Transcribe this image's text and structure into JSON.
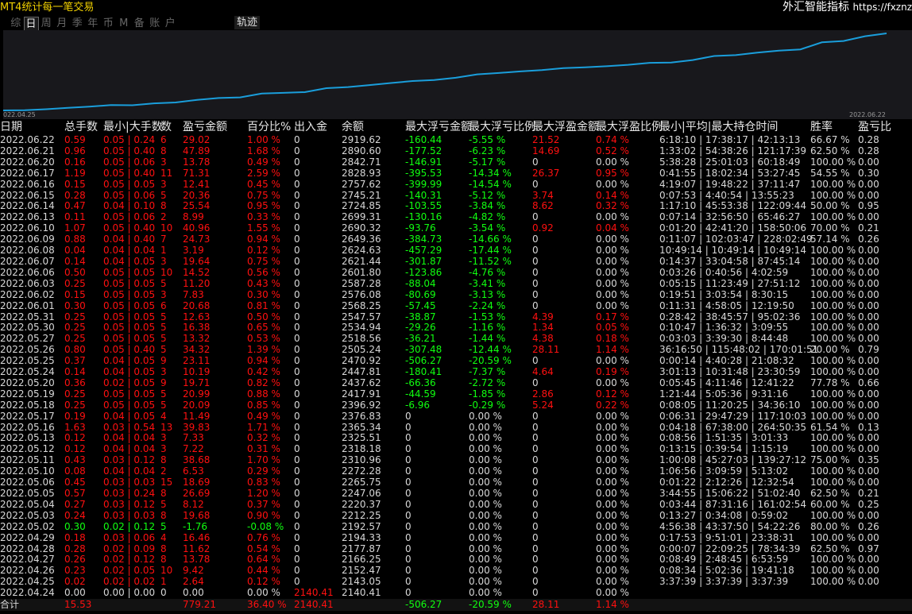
{
  "app": {
    "title": "MT4统计每一笔交易",
    "brand": "外汇智能指标",
    "url": "https://fxznz"
  },
  "tabs": [
    {
      "label": "综",
      "active": false
    },
    {
      "label": "日",
      "active": true
    },
    {
      "label": "周",
      "active": false
    },
    {
      "label": "月",
      "active": false
    },
    {
      "label": "季",
      "active": false
    },
    {
      "label": "年",
      "active": false
    },
    {
      "label": "币",
      "active": false
    },
    {
      "label": "M",
      "active": false
    },
    {
      "label": "备",
      "active": false
    },
    {
      "label": "账",
      "active": false
    },
    {
      "label": "户",
      "active": false
    }
  ],
  "track_button": "轨迹",
  "chart": {
    "start_label": "022.04.25",
    "end_label": "2022.06.22",
    "line_color": "#1a9edb"
  },
  "chart_data": {
    "type": "line",
    "x_start": "2022.04.24",
    "x_end": "2022.06.22",
    "y_series": [
      2140.41,
      2143.05,
      2152.47,
      2166.25,
      2177.87,
      2194.33,
      2192.57,
      2212.25,
      2220.37,
      2247.06,
      2265.75,
      2272.28,
      2310.96,
      2318.18,
      2325.51,
      2365.34,
      2376.83,
      2396.92,
      2417.91,
      2437.62,
      2447.81,
      2470.92,
      2505.24,
      2518.56,
      2534.94,
      2547.57,
      2568.25,
      2576.08,
      2587.28,
      2601.8,
      2621.44,
      2624.63,
      2649.36,
      2690.32,
      2699.31,
      2724.85,
      2745.21,
      2757.62,
      2828.93,
      2842.71,
      2890.6,
      2919.62
    ]
  },
  "headers": [
    "日期",
    "总手数",
    "最小|大手数",
    "数",
    "盈亏金额",
    "百分比%",
    "出入金",
    "余额",
    "最大浮亏金额",
    "最大浮亏比例",
    "最大浮盈金额",
    "最大浮盈比例",
    "最小|平均|最大持仓时间",
    "胜率",
    "盈亏比"
  ],
  "rows": [
    {
      "date": "2022.06.22",
      "lots": "0.59",
      "minmax": "0.05 | 0.24",
      "n": "6",
      "pl": "29.02",
      "pct": "1.00 %",
      "io": "0",
      "bal": "2919.62",
      "mfl": "-160.44",
      "mflp": "-5.55 %",
      "mfp": "21.52",
      "mfpp": "0.74 %",
      "time": "6:18:10 | 17:38:17 | 42:13:13",
      "win": "66.67 %",
      "ratio": "0.28",
      "neg": false
    },
    {
      "date": "2022.06.21",
      "lots": "0.96",
      "minmax": "0.05 | 0.40",
      "n": "8",
      "pl": "47.89",
      "pct": "1.68 %",
      "io": "0",
      "bal": "2890.60",
      "mfl": "-177.52",
      "mflp": "-6.23 %",
      "mfp": "14.69",
      "mfpp": "0.52 %",
      "time": "1:33:02 | 54:38:26 | 121:17:39",
      "win": "62.50 %",
      "ratio": "0.28",
      "neg": false
    },
    {
      "date": "2022.06.20",
      "lots": "0.16",
      "minmax": "0.05 | 0.06",
      "n": "3",
      "pl": "13.78",
      "pct": "0.49 %",
      "io": "0",
      "bal": "2842.71",
      "mfl": "-146.91",
      "mflp": "-5.17 %",
      "mfp": "0",
      "mfpp": "0.00 %",
      "time": "5:38:28 | 25:01:03 | 60:18:49",
      "win": "100.00 %",
      "ratio": "0.00",
      "neg": false
    },
    {
      "date": "2022.06.17",
      "lots": "1.19",
      "minmax": "0.05 | 0.40",
      "n": "11",
      "pl": "71.31",
      "pct": "2.59 %",
      "io": "0",
      "bal": "2828.93",
      "mfl": "-395.53",
      "mflp": "-14.34 %",
      "mfp": "26.37",
      "mfpp": "0.95 %",
      "time": "0:41:55 | 18:02:34 | 53:27:45",
      "win": "54.55 %",
      "ratio": "0.30",
      "neg": false
    },
    {
      "date": "2022.06.16",
      "lots": "0.15",
      "minmax": "0.05 | 0.05",
      "n": "3",
      "pl": "12.41",
      "pct": "0.45 %",
      "io": "0",
      "bal": "2757.62",
      "mfl": "-399.99",
      "mflp": "-14.54 %",
      "mfp": "0",
      "mfpp": "0.00 %",
      "time": "4:19:07 | 19:48:22 | 37:11:47",
      "win": "100.00 %",
      "ratio": "0.00",
      "neg": false
    },
    {
      "date": "2022.06.15",
      "lots": "0.28",
      "minmax": "0.05 | 0.06",
      "n": "5",
      "pl": "20.36",
      "pct": "0.75 %",
      "io": "0",
      "bal": "2745.21",
      "mfl": "-140.31",
      "mflp": "-5.12 %",
      "mfp": "3.74",
      "mfpp": "0.14 %",
      "time": "0:07:53 | 4:40:54 | 13:55:23",
      "win": "100.00 %",
      "ratio": "0.00",
      "neg": false
    },
    {
      "date": "2022.06.14",
      "lots": "0.47",
      "minmax": "0.04 | 0.10",
      "n": "8",
      "pl": "25.54",
      "pct": "0.95 %",
      "io": "0",
      "bal": "2724.85",
      "mfl": "-103.55",
      "mflp": "-3.84 %",
      "mfp": "8.62",
      "mfpp": "0.32 %",
      "time": "1:17:10 | 45:53:38 | 122:09:44",
      "win": "50.00 %",
      "ratio": "0.95",
      "neg": false
    },
    {
      "date": "2022.06.13",
      "lots": "0.11",
      "minmax": "0.05 | 0.06",
      "n": "2",
      "pl": "8.99",
      "pct": "0.33 %",
      "io": "0",
      "bal": "2699.31",
      "mfl": "-130.16",
      "mflp": "-4.82 %",
      "mfp": "0",
      "mfpp": "0.00 %",
      "time": "0:07:14 | 32:56:50 | 65:46:27",
      "win": "100.00 %",
      "ratio": "0.00",
      "neg": false
    },
    {
      "date": "2022.06.10",
      "lots": "1.07",
      "minmax": "0.05 | 0.40",
      "n": "10",
      "pl": "40.96",
      "pct": "1.55 %",
      "io": "0",
      "bal": "2690.32",
      "mfl": "-93.76",
      "mflp": "-3.54 %",
      "mfp": "0.92",
      "mfpp": "0.04 %",
      "time": "0:01:20 | 42:41:20 | 158:50:06",
      "win": "70.00 %",
      "ratio": "0.21",
      "neg": false
    },
    {
      "date": "2022.06.09",
      "lots": "0.88",
      "minmax": "0.04 | 0.40",
      "n": "7",
      "pl": "24.73",
      "pct": "0.94 %",
      "io": "0",
      "bal": "2649.36",
      "mfl": "-384.73",
      "mflp": "-14.66 %",
      "mfp": "0",
      "mfpp": "0.00 %",
      "time": "0:11:07 | 102:03:47 | 228:02:49",
      "win": "57.14 %",
      "ratio": "0.26",
      "neg": false
    },
    {
      "date": "2022.06.08",
      "lots": "0.04",
      "minmax": "0.04 | 0.04",
      "n": "1",
      "pl": "3.19",
      "pct": "0.12 %",
      "io": "0",
      "bal": "2624.63",
      "mfl": "-457.29",
      "mflp": "-17.44 %",
      "mfp": "0",
      "mfpp": "0.00 %",
      "time": "10:49:14 | 10:49:14 | 10:49:14",
      "win": "100.00 %",
      "ratio": "0.00",
      "neg": false
    },
    {
      "date": "2022.06.07",
      "lots": "0.14",
      "minmax": "0.04 | 0.05",
      "n": "3",
      "pl": "19.64",
      "pct": "0.75 %",
      "io": "0",
      "bal": "2621.44",
      "mfl": "-301.87",
      "mflp": "-11.52 %",
      "mfp": "0",
      "mfpp": "0.00 %",
      "time": "0:14:37 | 33:04:58 | 87:45:14",
      "win": "100.00 %",
      "ratio": "0.00",
      "neg": false
    },
    {
      "date": "2022.06.06",
      "lots": "0.50",
      "minmax": "0.05 | 0.05",
      "n": "10",
      "pl": "14.52",
      "pct": "0.56 %",
      "io": "0",
      "bal": "2601.80",
      "mfl": "-123.86",
      "mflp": "-4.76 %",
      "mfp": "0",
      "mfpp": "0.00 %",
      "time": "0:03:26 | 0:40:56 | 4:02:59",
      "win": "100.00 %",
      "ratio": "0.00",
      "neg": false
    },
    {
      "date": "2022.06.03",
      "lots": "0.25",
      "minmax": "0.05 | 0.05",
      "n": "5",
      "pl": "11.20",
      "pct": "0.43 %",
      "io": "0",
      "bal": "2587.28",
      "mfl": "-88.04",
      "mflp": "-3.41 %",
      "mfp": "0",
      "mfpp": "0.00 %",
      "time": "0:05:15 | 11:23:49 | 27:51:12",
      "win": "100.00 %",
      "ratio": "0.00",
      "neg": false
    },
    {
      "date": "2022.06.02",
      "lots": "0.15",
      "minmax": "0.05 | 0.05",
      "n": "3",
      "pl": "7.83",
      "pct": "0.30 %",
      "io": "0",
      "bal": "2576.08",
      "mfl": "-80.69",
      "mflp": "-3.13 %",
      "mfp": "0",
      "mfpp": "0.00 %",
      "time": "0:19:51 | 3:03:54 | 8:30:15",
      "win": "100.00 %",
      "ratio": "0.00",
      "neg": false
    },
    {
      "date": "2022.06.01",
      "lots": "0.30",
      "minmax": "0.05 | 0.05",
      "n": "6",
      "pl": "20.68",
      "pct": "0.81 %",
      "io": "0",
      "bal": "2568.25",
      "mfl": "-57.45",
      "mflp": "-2.24 %",
      "mfp": "0",
      "mfpp": "0.00 %",
      "time": "0:11:31 | 4:58:05 | 12:19:50",
      "win": "100.00 %",
      "ratio": "0.00",
      "neg": false
    },
    {
      "date": "2022.05.31",
      "lots": "0.25",
      "minmax": "0.05 | 0.05",
      "n": "5",
      "pl": "12.63",
      "pct": "0.50 %",
      "io": "0",
      "bal": "2547.57",
      "mfl": "-38.87",
      "mflp": "-1.53 %",
      "mfp": "4.39",
      "mfpp": "0.17 %",
      "time": "0:28:42 | 38:45:57 | 95:02:36",
      "win": "100.00 %",
      "ratio": "0.00",
      "neg": false
    },
    {
      "date": "2022.05.30",
      "lots": "0.25",
      "minmax": "0.05 | 0.05",
      "n": "5",
      "pl": "16.38",
      "pct": "0.65 %",
      "io": "0",
      "bal": "2534.94",
      "mfl": "-29.26",
      "mflp": "-1.16 %",
      "mfp": "1.34",
      "mfpp": "0.05 %",
      "time": "0:10:47 | 1:36:32 | 3:09:55",
      "win": "100.00 %",
      "ratio": "0.00",
      "neg": false
    },
    {
      "date": "2022.05.27",
      "lots": "0.25",
      "minmax": "0.05 | 0.05",
      "n": "5",
      "pl": "13.32",
      "pct": "0.53 %",
      "io": "0",
      "bal": "2518.56",
      "mfl": "-36.21",
      "mflp": "-1.44 %",
      "mfp": "4.38",
      "mfpp": "0.18 %",
      "time": "0:03:03 | 3:39:30 | 8:44:48",
      "win": "100.00 %",
      "ratio": "0.00",
      "neg": false
    },
    {
      "date": "2022.05.26",
      "lots": "0.80",
      "minmax": "0.05 | 0.40",
      "n": "5",
      "pl": "34.32",
      "pct": "1.39 %",
      "io": "0",
      "bal": "2505.24",
      "mfl": "-307.48",
      "mflp": "-12.44 %",
      "mfp": "28.11",
      "mfpp": "1.14 %",
      "time": "36:16:50 | 115:48:02 | 170:01:51",
      "win": "20.00 %",
      "ratio": "0.79",
      "neg": false
    },
    {
      "date": "2022.05.25",
      "lots": "0.37",
      "minmax": "0.04 | 0.05",
      "n": "9",
      "pl": "23.11",
      "pct": "0.94 %",
      "io": "0",
      "bal": "2470.92",
      "mfl": "-506.27",
      "mflp": "-20.59 %",
      "mfp": "0",
      "mfpp": "0.00 %",
      "time": "0:00:14 | 4:40:28 | 21:08:32",
      "win": "100.00 %",
      "ratio": "0.00",
      "neg": false
    },
    {
      "date": "2022.05.24",
      "lots": "0.14",
      "minmax": "0.04 | 0.05",
      "n": "3",
      "pl": "10.19",
      "pct": "0.42 %",
      "io": "0",
      "bal": "2447.81",
      "mfl": "-180.41",
      "mflp": "-7.37 %",
      "mfp": "4.64",
      "mfpp": "0.19 %",
      "time": "3:01:13 | 10:31:48 | 23:30:59",
      "win": "100.00 %",
      "ratio": "0.00",
      "neg": false
    },
    {
      "date": "2022.05.20",
      "lots": "0.36",
      "minmax": "0.02 | 0.05",
      "n": "9",
      "pl": "19.71",
      "pct": "0.82 %",
      "io": "0",
      "bal": "2437.62",
      "mfl": "-66.36",
      "mflp": "-2.72 %",
      "mfp": "0",
      "mfpp": "0.00 %",
      "time": "0:05:45 | 4:11:46 | 12:41:22",
      "win": "77.78 %",
      "ratio": "0.66",
      "neg": false
    },
    {
      "date": "2022.05.19",
      "lots": "0.25",
      "minmax": "0.05 | 0.05",
      "n": "5",
      "pl": "20.99",
      "pct": "0.88 %",
      "io": "0",
      "bal": "2417.91",
      "mfl": "-44.59",
      "mflp": "-1.85 %",
      "mfp": "2.86",
      "mfpp": "0.12 %",
      "time": "1:21:44 | 5:05:36 | 9:31:16",
      "win": "100.00 %",
      "ratio": "0.00",
      "neg": false
    },
    {
      "date": "2022.05.18",
      "lots": "0.25",
      "minmax": "0.05 | 0.05",
      "n": "5",
      "pl": "20.09",
      "pct": "0.85 %",
      "io": "0",
      "bal": "2396.92",
      "mfl": "-6.96",
      "mflp": "-0.29 %",
      "mfp": "5.24",
      "mfpp": "0.22 %",
      "time": "0:08:05 | 11:20:25 | 34:36:10",
      "win": "100.00 %",
      "ratio": "0.00",
      "neg": false
    },
    {
      "date": "2022.05.17",
      "lots": "0.19",
      "minmax": "0.04 | 0.05",
      "n": "4",
      "pl": "11.49",
      "pct": "0.49 %",
      "io": "0",
      "bal": "2376.83",
      "mfl": "0",
      "mflp": "0.00 %",
      "mfp": "0",
      "mfpp": "0.00 %",
      "time": "0:06:31 | 29:47:29 | 117:10:03",
      "win": "100.00 %",
      "ratio": "0.00",
      "neg": false
    },
    {
      "date": "2022.05.16",
      "lots": "1.63",
      "minmax": "0.03 | 0.54",
      "n": "13",
      "pl": "39.83",
      "pct": "1.71 %",
      "io": "0",
      "bal": "2365.34",
      "mfl": "0",
      "mflp": "0.00 %",
      "mfp": "0",
      "mfpp": "0.00 %",
      "time": "0:04:18 | 67:38:00 | 264:50:35",
      "win": "61.54 %",
      "ratio": "0.13",
      "neg": false
    },
    {
      "date": "2022.05.13",
      "lots": "0.12",
      "minmax": "0.04 | 0.04",
      "n": "3",
      "pl": "7.33",
      "pct": "0.32 %",
      "io": "0",
      "bal": "2325.51",
      "mfl": "0",
      "mflp": "0.00 %",
      "mfp": "0",
      "mfpp": "0.00 %",
      "time": "0:08:56 | 1:51:35 | 3:01:33",
      "win": "100.00 %",
      "ratio": "0.00",
      "neg": false
    },
    {
      "date": "2022.05.12",
      "lots": "0.12",
      "minmax": "0.04 | 0.04",
      "n": "3",
      "pl": "7.22",
      "pct": "0.31 %",
      "io": "0",
      "bal": "2318.18",
      "mfl": "0",
      "mflp": "0.00 %",
      "mfp": "0",
      "mfpp": "0.00 %",
      "time": "0:13:15 | 0:39:54 | 1:15:19",
      "win": "100.00 %",
      "ratio": "0.00",
      "neg": false
    },
    {
      "date": "2022.05.11",
      "lots": "0.43",
      "minmax": "0.03 | 0.12",
      "n": "8",
      "pl": "38.68",
      "pct": "1.70 %",
      "io": "0",
      "bal": "2310.96",
      "mfl": "0",
      "mflp": "0.00 %",
      "mfp": "0",
      "mfpp": "0.00 %",
      "time": "1:00:08 | 45:27:03 | 139:27:12",
      "win": "75.00 %",
      "ratio": "0.35",
      "neg": false
    },
    {
      "date": "2022.05.10",
      "lots": "0.08",
      "minmax": "0.04 | 0.04",
      "n": "2",
      "pl": "6.53",
      "pct": "0.29 %",
      "io": "0",
      "bal": "2272.28",
      "mfl": "0",
      "mflp": "0.00 %",
      "mfp": "0",
      "mfpp": "0.00 %",
      "time": "1:06:56 | 3:09:59 | 5:13:02",
      "win": "100.00 %",
      "ratio": "0.00",
      "neg": false
    },
    {
      "date": "2022.05.06",
      "lots": "0.45",
      "minmax": "0.03 | 0.03",
      "n": "15",
      "pl": "18.69",
      "pct": "0.83 %",
      "io": "0",
      "bal": "2265.75",
      "mfl": "0",
      "mflp": "0.00 %",
      "mfp": "0",
      "mfpp": "0.00 %",
      "time": "0:01:22 | 2:12:26 | 12:32:54",
      "win": "100.00 %",
      "ratio": "0.00",
      "neg": false
    },
    {
      "date": "2022.05.05",
      "lots": "0.57",
      "minmax": "0.03 | 0.24",
      "n": "8",
      "pl": "26.69",
      "pct": "1.20 %",
      "io": "0",
      "bal": "2247.06",
      "mfl": "0",
      "mflp": "0.00 %",
      "mfp": "0",
      "mfpp": "0.00 %",
      "time": "3:44:55 | 15:06:22 | 51:02:40",
      "win": "62.50 %",
      "ratio": "0.21",
      "neg": false
    },
    {
      "date": "2022.05.04",
      "lots": "0.27",
      "minmax": "0.03 | 0.12",
      "n": "5",
      "pl": "8.12",
      "pct": "0.37 %",
      "io": "0",
      "bal": "2220.37",
      "mfl": "0",
      "mflp": "0.00 %",
      "mfp": "0",
      "mfpp": "0.00 %",
      "time": "0:03:44 | 87:31:16 | 161:02:54",
      "win": "60.00 %",
      "ratio": "0.25",
      "neg": false
    },
    {
      "date": "2022.05.03",
      "lots": "0.24",
      "minmax": "0.03 | 0.03",
      "n": "8",
      "pl": "19.68",
      "pct": "0.90 %",
      "io": "0",
      "bal": "2212.25",
      "mfl": "0",
      "mflp": "0.00 %",
      "mfp": "0",
      "mfpp": "0.00 %",
      "time": "0:13:27 | 0:34:08 | 0:59:02",
      "win": "100.00 %",
      "ratio": "0.00",
      "neg": false
    },
    {
      "date": "2022.05.02",
      "lots": "0.30",
      "minmax": "0.02 | 0.12",
      "n": "5",
      "pl": "-1.76",
      "pct": "-0.08 %",
      "io": "0",
      "bal": "2192.57",
      "mfl": "0",
      "mflp": "0.00 %",
      "mfp": "0",
      "mfpp": "0.00 %",
      "time": "4:56:38 | 43:37:50 | 54:22:26",
      "win": "80.00 %",
      "ratio": "0.26",
      "neg": true
    },
    {
      "date": "2022.04.29",
      "lots": "0.18",
      "minmax": "0.03 | 0.06",
      "n": "4",
      "pl": "16.46",
      "pct": "0.76 %",
      "io": "0",
      "bal": "2194.33",
      "mfl": "0",
      "mflp": "0.00 %",
      "mfp": "0",
      "mfpp": "0.00 %",
      "time": "0:17:53 | 9:51:01 | 23:38:31",
      "win": "100.00 %",
      "ratio": "0.00",
      "neg": false
    },
    {
      "date": "2022.04.28",
      "lots": "0.28",
      "minmax": "0.02 | 0.09",
      "n": "8",
      "pl": "11.62",
      "pct": "0.54 %",
      "io": "0",
      "bal": "2177.87",
      "mfl": "0",
      "mflp": "0.00 %",
      "mfp": "0",
      "mfpp": "0.00 %",
      "time": "0:00:07 | 22:09:25 | 78:34:39",
      "win": "62.50 %",
      "ratio": "0.97",
      "neg": false
    },
    {
      "date": "2022.04.27",
      "lots": "0.26",
      "minmax": "0.02 | 0.12",
      "n": "8",
      "pl": "13.78",
      "pct": "0.64 %",
      "io": "0",
      "bal": "2166.25",
      "mfl": "0",
      "mflp": "0.00 %",
      "mfp": "0",
      "mfpp": "0.00 %",
      "time": "0:08:49 | 2:48:45 | 6:53:59",
      "win": "100.00 %",
      "ratio": "0.00",
      "neg": false
    },
    {
      "date": "2022.04.26",
      "lots": "0.23",
      "minmax": "0.02 | 0.05",
      "n": "10",
      "pl": "9.42",
      "pct": "0.44 %",
      "io": "0",
      "bal": "2152.47",
      "mfl": "0",
      "mflp": "0.00 %",
      "mfp": "0",
      "mfpp": "0.00 %",
      "time": "0:08:34 | 5:02:36 | 19:41:18",
      "win": "100.00 %",
      "ratio": "0.00",
      "neg": false
    },
    {
      "date": "2022.04.25",
      "lots": "0.02",
      "minmax": "0.02 | 0.02",
      "n": "1",
      "pl": "2.64",
      "pct": "0.12 %",
      "io": "0",
      "bal": "2143.05",
      "mfl": "0",
      "mflp": "0.00 %",
      "mfp": "0",
      "mfpp": "0.00 %",
      "time": "3:37:39 | 3:37:39 | 3:37:39",
      "win": "100.00 %",
      "ratio": "0.00",
      "neg": false
    },
    {
      "date": "2022.04.24",
      "lots": "0.00",
      "minmax": "0.00 | 0.00",
      "n": "0",
      "pl": "0.00",
      "pct": "0.00 %",
      "io": "2140.41",
      "bal": "2140.41",
      "mfl": "0",
      "mflp": "0.00 %",
      "mfp": "0",
      "mfpp": "0.00 %",
      "time": "",
      "win": "",
      "ratio": "",
      "neg": false,
      "deposit": true
    }
  ],
  "totals": {
    "label": "合计",
    "lots": "15.53",
    "pl": "779.21",
    "pct": "36.40 %",
    "io": "2140.41",
    "mfl": "-506.27",
    "mflp": "-20.59 %",
    "mfp": "28.11",
    "mfpp": "1.14 %"
  }
}
